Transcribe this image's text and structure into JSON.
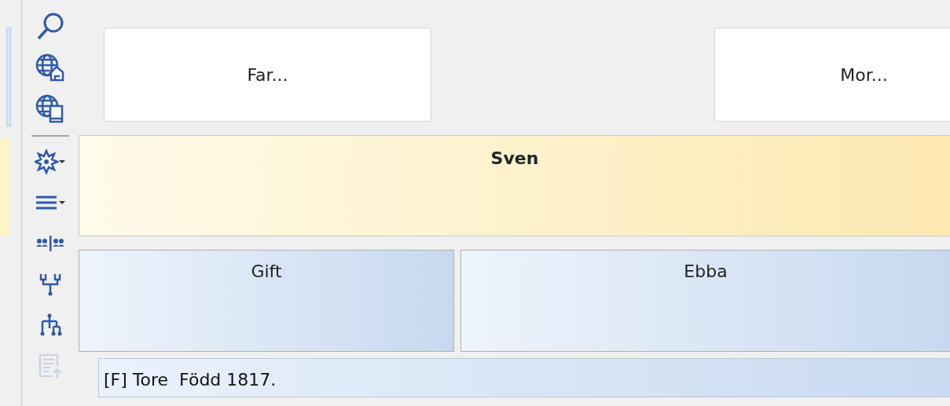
{
  "toolbar": [
    {
      "kind": "search",
      "disabled": false
    },
    {
      "kind": "globe-edit",
      "disabled": false
    },
    {
      "kind": "globe-book",
      "disabled": false
    },
    {
      "kind": "separator"
    },
    {
      "kind": "star-menu",
      "disabled": false
    },
    {
      "kind": "list-menu",
      "disabled": false
    },
    {
      "kind": "pairs",
      "disabled": false
    },
    {
      "kind": "tree-down",
      "disabled": false
    },
    {
      "kind": "tree-up",
      "disabled": false
    },
    {
      "kind": "export",
      "disabled": true
    }
  ],
  "parents": [
    {
      "label": "Far..."
    },
    {
      "label": "Mor..."
    }
  ],
  "person": {
    "name": "Sven"
  },
  "marriage": {
    "label": "Gift"
  },
  "spouse": {
    "name": "Ebba"
  },
  "children": [
    {
      "text": "[F] Tore  Född 1817."
    }
  ]
}
